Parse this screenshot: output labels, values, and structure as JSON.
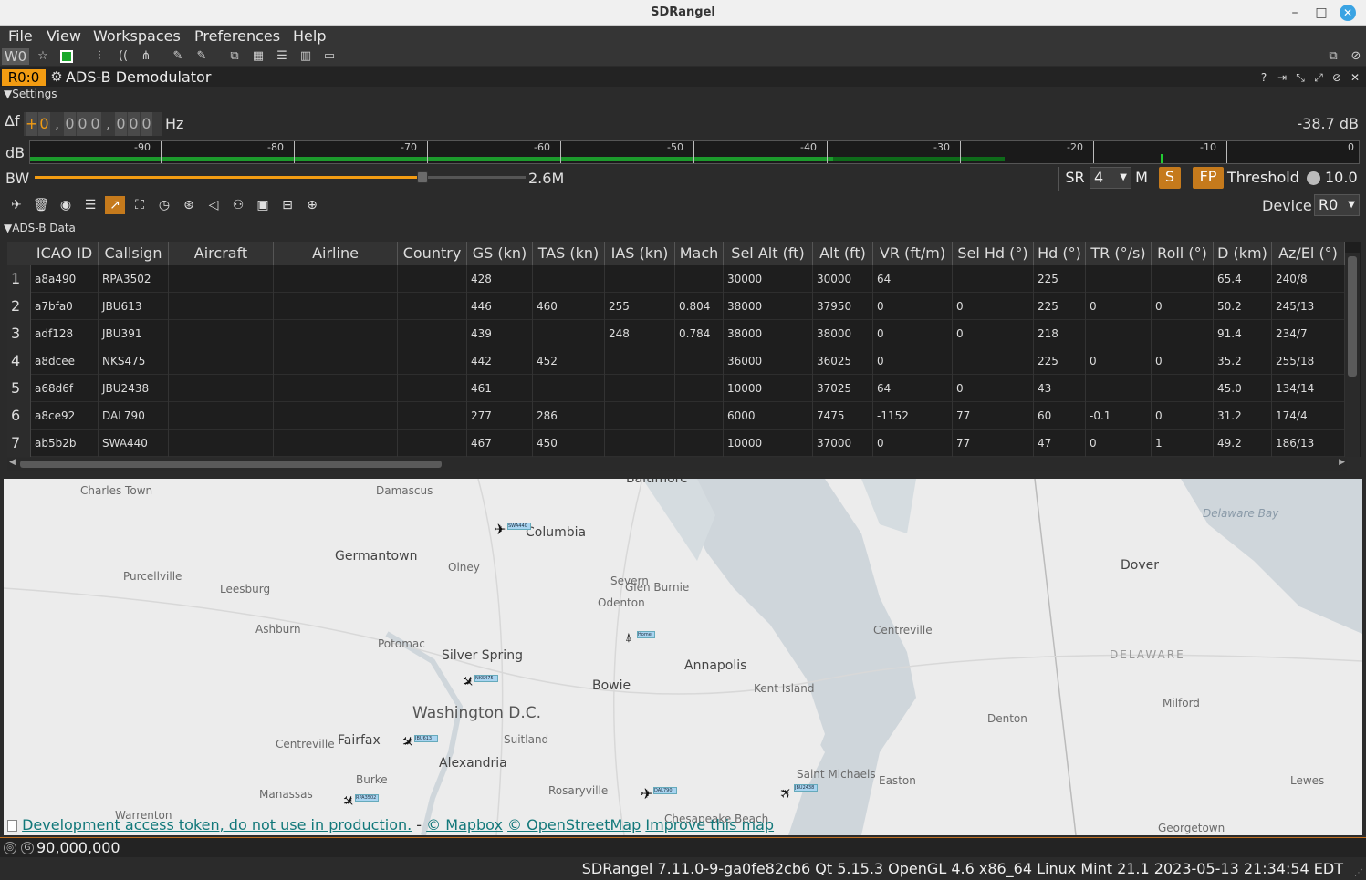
{
  "window": {
    "title": "SDRangel"
  },
  "menu": [
    "File",
    "View",
    "Workspaces",
    "Preferences",
    "Help"
  ],
  "toolbar": {
    "workspace": "W0"
  },
  "channel": {
    "badge": "R0:0",
    "title": "ADS-B Demodulator"
  },
  "settings_label": "Settings",
  "frequency": {
    "delta_label": "Δf",
    "digits": [
      "+",
      "0",
      ",",
      "0",
      "0",
      "0",
      ",",
      "0",
      "0",
      "0"
    ],
    "unit": "Hz",
    "level": "-38.7 dB"
  },
  "scale": {
    "label": "dB",
    "ticks": [
      "-90",
      "-80",
      "-70",
      "-60",
      "-50",
      "-40",
      "-30",
      "-20",
      "-10",
      "0"
    ]
  },
  "bandwidth": {
    "label": "BW",
    "value": "2.6M",
    "level": 0.79
  },
  "controls": {
    "sr_label": "SR",
    "sr_value": "4",
    "m_label": "M",
    "s_label": "S",
    "fp_label": "FP",
    "threshold_label": "Threshold",
    "threshold_value": "10.0",
    "device_label": "Device",
    "device_value": "R0"
  },
  "data_label": "ADS-B Data",
  "table": {
    "columns": [
      "ICAO ID",
      "Callsign",
      "Aircraft",
      "Airline",
      "Country",
      "GS (kn)",
      "TAS (kn)",
      "IAS (kn)",
      "Mach",
      "Sel Alt (ft)",
      "Alt (ft)",
      "VR (ft/m)",
      "Sel Hd (°)",
      "Hd (°)",
      "TR (°/s)",
      "Roll (°)",
      "D (km)",
      "Az/El (°)"
    ],
    "rows": [
      [
        "a8a490",
        "RPA3502",
        "",
        "",
        "",
        "428",
        "",
        "",
        "",
        "30000",
        "30000",
        "64",
        "",
        "225",
        "",
        "",
        "65.4",
        "240/8"
      ],
      [
        "a7bfa0",
        "JBU613",
        "",
        "",
        "",
        "446",
        "460",
        "255",
        "0.804",
        "38000",
        "37950",
        "0",
        "0",
        "225",
        "0",
        "0",
        "50.2",
        "245/13"
      ],
      [
        "adf128",
        "JBU391",
        "",
        "",
        "",
        "439",
        "",
        "248",
        "0.784",
        "38000",
        "38000",
        "0",
        "0",
        "218",
        "",
        "",
        "91.4",
        "234/7"
      ],
      [
        "a8dcee",
        "NKS475",
        "",
        "",
        "",
        "442",
        "452",
        "",
        "",
        "36000",
        "36025",
        "0",
        "",
        "225",
        "0",
        "0",
        "35.2",
        "255/18"
      ],
      [
        "a68d6f",
        "JBU2438",
        "",
        "",
        "",
        "461",
        "",
        "",
        "",
        "10000",
        "37025",
        "64",
        "0",
        "43",
        "",
        "",
        "45.0",
        "134/14"
      ],
      [
        "a8ce92",
        "DAL790",
        "",
        "",
        "",
        "277",
        "286",
        "",
        "",
        "6000",
        "7475",
        "-1152",
        "77",
        "60",
        "-0.1",
        "0",
        "31.2",
        "174/4"
      ],
      [
        "ab5b2b",
        "SWA440",
        "",
        "",
        "",
        "467",
        "450",
        "",
        "",
        "10000",
        "37000",
        "0",
        "77",
        "47",
        "0",
        "1",
        "49.2",
        "186/13"
      ]
    ]
  },
  "map": {
    "places": {
      "baltimore": "Baltimore",
      "charles_town": "Charles Town",
      "damascus": "Damascus",
      "columbia": "Columbia",
      "germantown": "Germantown",
      "purcellville": "Purcellville",
      "olney": "Olney",
      "glen_burnie": "Glen Burnie",
      "severn": "Severn",
      "odenton": "Odenton",
      "leesburg": "Leesburg",
      "ashburn": "Ashburn",
      "potomac": "Potomac",
      "silver_spring": "Silver Spring",
      "bowie": "Bowie",
      "annapolis": "Annapolis",
      "washington": "Washington D.C.",
      "fairfax": "Fairfax",
      "centreville": "Centreville",
      "suitland": "Suitland",
      "alexandria": "Alexandria",
      "burke": "Burke",
      "manassas": "Manassas",
      "rosaryville": "Rosaryville",
      "warrenton": "Warrenton",
      "chesapeake_beach": "Chesapeake Beach",
      "kent_island": "Kent Island",
      "saint_michaels": "Saint Michaels",
      "easton": "Easton",
      "centreville_md": "Centreville",
      "dover": "Dover",
      "delaware": "DELAWARE",
      "delaware_bay": "Delaware Bay",
      "milford": "Milford",
      "denton": "Denton",
      "lewes": "Lewes",
      "georgetown": "Georgetown"
    },
    "aircraft_tags": [
      "SWA440",
      "NKS475",
      "JBU613",
      "RPA3502",
      "DAL790",
      "JBU2438"
    ],
    "station_tag": "Home",
    "footer": {
      "dev_token": "Development access token, do not use in production.",
      "sep": "-",
      "mapbox": "© Mapbox",
      "osm": "© OpenStreetMap",
      "improve": "Improve this map"
    }
  },
  "center_frequency": "90,000,000",
  "status": "SDRangel 7.11.0-9-ga0fe82cb6 Qt 5.15.3 OpenGL 4.6 x86_64 Linux Mint 21.1 2023-05-13 21:34:54 EDT",
  "colors": {
    "accent": "#f39c12",
    "table_bg": "#1e1e1e",
    "meter_green": "#1c9a2c",
    "map_water": "#cfd6db"
  }
}
